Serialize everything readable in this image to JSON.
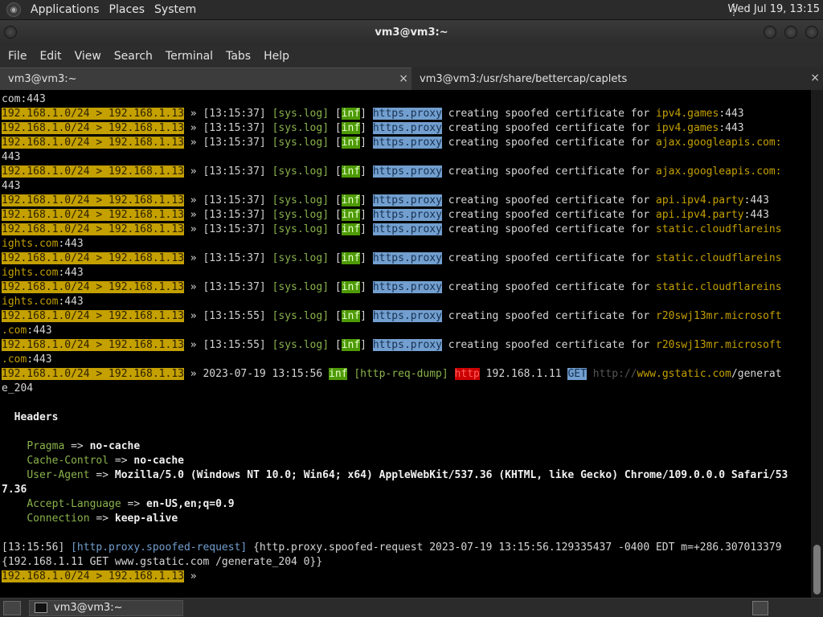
{
  "panel": {
    "menus": [
      "Applications",
      "Places",
      "System"
    ],
    "clock": "Wed Jul 19, 13:15"
  },
  "window": {
    "title": "vm3@vm3:~"
  },
  "menubar": [
    "File",
    "Edit",
    "View",
    "Search",
    "Terminal",
    "Tabs",
    "Help"
  ],
  "tabs": [
    {
      "label": "vm3@vm3:~",
      "close": "×"
    },
    {
      "label": "vm3@vm3:/usr/share/bettercap/caplets",
      "close": "×"
    }
  ],
  "prompt": "192.168.1.0/24 > 192.168.1.13",
  "log_lines": [
    {
      "time": "[13:15:37]",
      "host": "ipv4.games",
      "port": ":443",
      "wrap": ""
    },
    {
      "time": "[13:15:37]",
      "host": "ipv4.games",
      "port": ":443",
      "wrap": ""
    },
    {
      "time": "[13:15:37]",
      "host": "ajax.googleapis.com:",
      "port": "",
      "wrap": "443"
    },
    {
      "time": "[13:15:37]",
      "host": "ajax.googleapis.com:",
      "port": "",
      "wrap": "443"
    },
    {
      "time": "[13:15:37]",
      "host": "api.ipv4.party",
      "port": ":443",
      "wrap": ""
    },
    {
      "time": "[13:15:37]",
      "host": "api.ipv4.party",
      "port": ":443",
      "wrap": ""
    },
    {
      "time": "[13:15:37]",
      "host": "static.cloudflareins",
      "port": "",
      "wrap": "ights.com:443"
    },
    {
      "time": "[13:15:37]",
      "host": "static.cloudflareins",
      "port": "",
      "wrap": "ights.com:443"
    },
    {
      "time": "[13:15:37]",
      "host": "static.cloudflareins",
      "port": "",
      "wrap": "ights.com:443"
    },
    {
      "time": "[13:15:55]",
      "host": "r20swj13mr.microsoft",
      "port": "",
      "wrap": ".com:443"
    },
    {
      "time": "[13:15:55]",
      "host": "r20swj13mr.microsoft",
      "port": "",
      "wrap": ".com:443"
    }
  ],
  "log_tokens": {
    "sep": "»",
    "syslog": "[sys.log]",
    "inf": "inf",
    "module": "https.proxy",
    "message": "creating spoofed certificate for"
  },
  "first_line": "com:443",
  "dump": {
    "datetime": "2023-07-19 13:15:56",
    "inf": "inf",
    "tag": "[http-req-dump]",
    "proto": "http",
    "client": "192.168.1.11",
    "method": "GET",
    "url_prefix": "http://",
    "url_host": "www.gstatic.com",
    "url_path": "/generat",
    "url_wrap": "e_204"
  },
  "headers_title": "Headers",
  "headers": [
    {
      "key": "Pragma",
      "value": "no-cache"
    },
    {
      "key": "Cache-Control",
      "value": "no-cache"
    },
    {
      "key": "User-Agent",
      "value": "Mozilla/5.0 (Windows NT 10.0; Win64; x64) AppleWebKit/537.36 (KHTML, like Gecko) Chrome/109.0.0.0 Safari/53",
      "wrap": "7.36"
    },
    {
      "key": "Accept-Language",
      "value": "en-US,en;q=0.9"
    },
    {
      "key": "Connection",
      "value": "keep-alive"
    }
  ],
  "spoofed": {
    "time": "[13:15:56]",
    "tag": "[http.proxy.spoofed-request]",
    "line1": "{http.proxy.spoofed-request 2023-07-19 13:15:56.129335437 -0400 EDT m=+286.307013379",
    "line2": "{192.168.1.11 GET www.gstatic.com /generate_204 0}}"
  },
  "taskbar": {
    "task_label": "vm3@vm3:~"
  }
}
